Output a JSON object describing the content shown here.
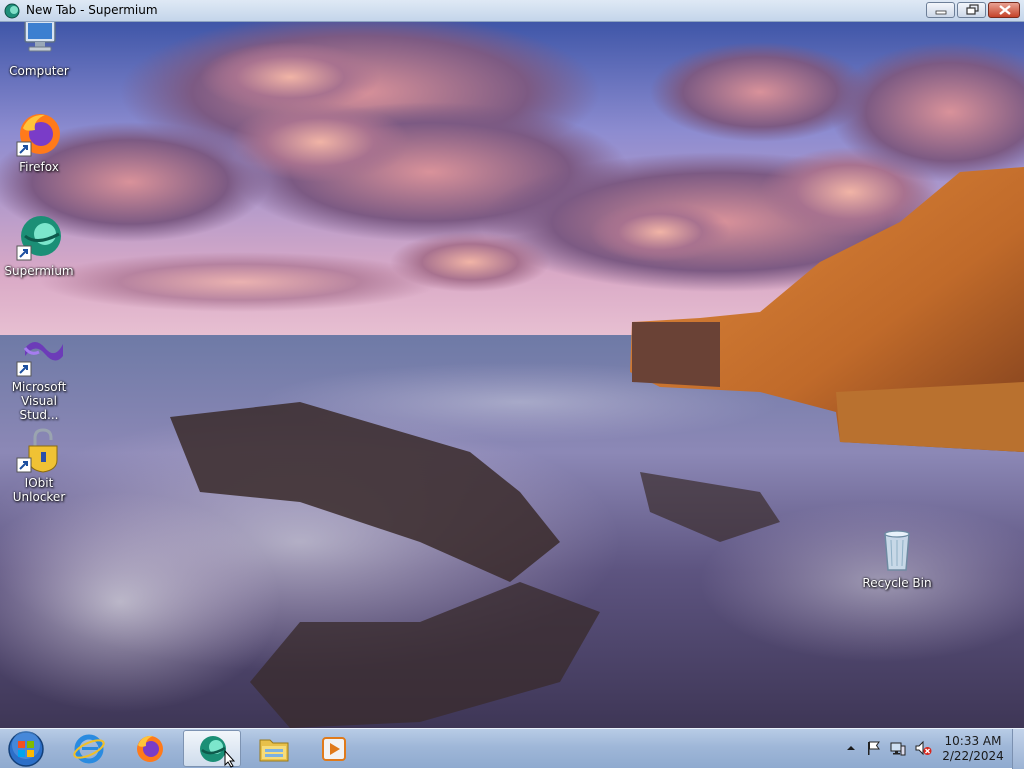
{
  "window": {
    "title": "New Tab - Supermium",
    "minimize_icon": "minimize-icon",
    "maximize_icon": "restore-icon",
    "close_icon": "close-icon"
  },
  "desktop": {
    "icons": [
      {
        "label": "Computer",
        "icon": "computer-icon"
      },
      {
        "label": "Firefox",
        "icon": "firefox-icon"
      },
      {
        "label": "Supermium",
        "icon": "supermium-icon"
      },
      {
        "label": "Microsoft Visual Stud...",
        "icon": "visual-studio-icon"
      },
      {
        "label": "IObit Unlocker",
        "icon": "iobit-unlocker-icon"
      },
      {
        "label": "Recycle Bin",
        "icon": "recycle-bin-icon"
      }
    ]
  },
  "taskbar": {
    "start_icon": "windows-start-icon",
    "items": [
      {
        "icon": "internet-explorer-icon"
      },
      {
        "icon": "firefox-icon"
      },
      {
        "icon": "supermium-icon",
        "active": true
      },
      {
        "icon": "file-explorer-icon"
      },
      {
        "icon": "media-player-icon"
      }
    ],
    "tray": {
      "icons": [
        "show-hidden-icons-icon",
        "action-center-flag-icon",
        "network-icon",
        "volume-muted-icon"
      ],
      "time": "10:33 AM",
      "date": "2/22/2024"
    }
  }
}
